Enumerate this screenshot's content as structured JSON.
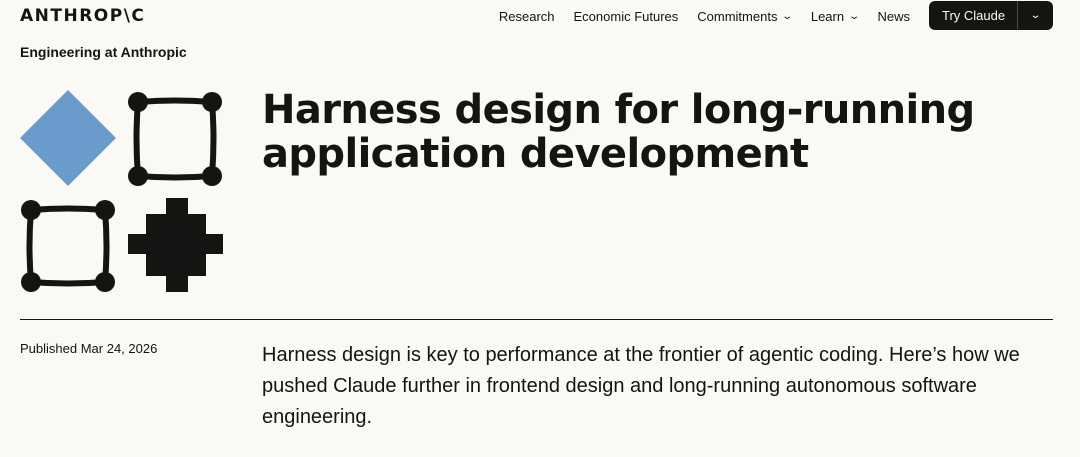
{
  "header": {
    "logo_text": "ANTHROP\\C",
    "nav": [
      {
        "label": "Research",
        "has_dropdown": false
      },
      {
        "label": "Economic Futures",
        "has_dropdown": false
      },
      {
        "label": "Commitments",
        "has_dropdown": true
      },
      {
        "label": "Learn",
        "has_dropdown": true
      },
      {
        "label": "News",
        "has_dropdown": false
      }
    ],
    "cta_label": "Try Claude"
  },
  "section_label": "Engineering at Anthropic",
  "article": {
    "title": "Harness design for long-running application development",
    "published": "Published Mar 24, 2026",
    "summary": "Harness design is key to performance at the frontier of agentic coding. Here’s how we pushed Claude further in frontend design and long-running autonomous software engineering."
  },
  "colors": {
    "background": "#faf9f5",
    "text": "#141413",
    "accent_blue": "#6a9bcc"
  },
  "icons": [
    "chevron-down-icon",
    "diamond-icon",
    "square-nodes-icon",
    "cross-block-icon"
  ]
}
